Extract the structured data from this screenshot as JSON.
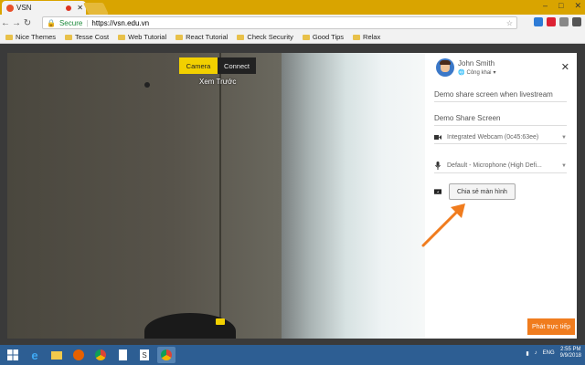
{
  "browser": {
    "tab_title": "VSN",
    "url_secure_label": "Secure",
    "url": "https://vsn.edu.vn"
  },
  "bookmarks": [
    {
      "label": "Nice Themes"
    },
    {
      "label": "Tesse Cost"
    },
    {
      "label": "Web Tutorial"
    },
    {
      "label": "React Tutorial"
    },
    {
      "label": "Check Security"
    },
    {
      "label": "Good Tips"
    },
    {
      "label": "Relax"
    }
  ],
  "video": {
    "tab_camera": "Camera",
    "tab_connect": "Connect",
    "preview_label": "Xem Trước"
  },
  "panel": {
    "user_name": "John Smith",
    "privacy": "Công khai",
    "title_value": "Demo share screen when livestream",
    "description_value": "Demo Share Screen",
    "camera_select": "Integrated Webcam (0c45:63ee)",
    "mic_select": "Default - Microphone (High Defi...",
    "share_button": "Chia sẻ màn hình",
    "live_button": "Phát trực tiếp",
    "close_glyph": "✕"
  },
  "taskbar": {
    "lang": "ENG",
    "time": "2:55 PM",
    "date": "9/9/2018"
  },
  "colors": {
    "accent_yellow": "#f2d000",
    "live_orange": "#f07c1e",
    "arrow_orange": "#f07c1e",
    "tab_strip": "#d9a400",
    "taskbar": "#2d5e93"
  },
  "icons": {
    "camera": "camera-icon",
    "mic": "microphone-icon",
    "screen": "screen-share-icon",
    "close": "close-icon"
  }
}
